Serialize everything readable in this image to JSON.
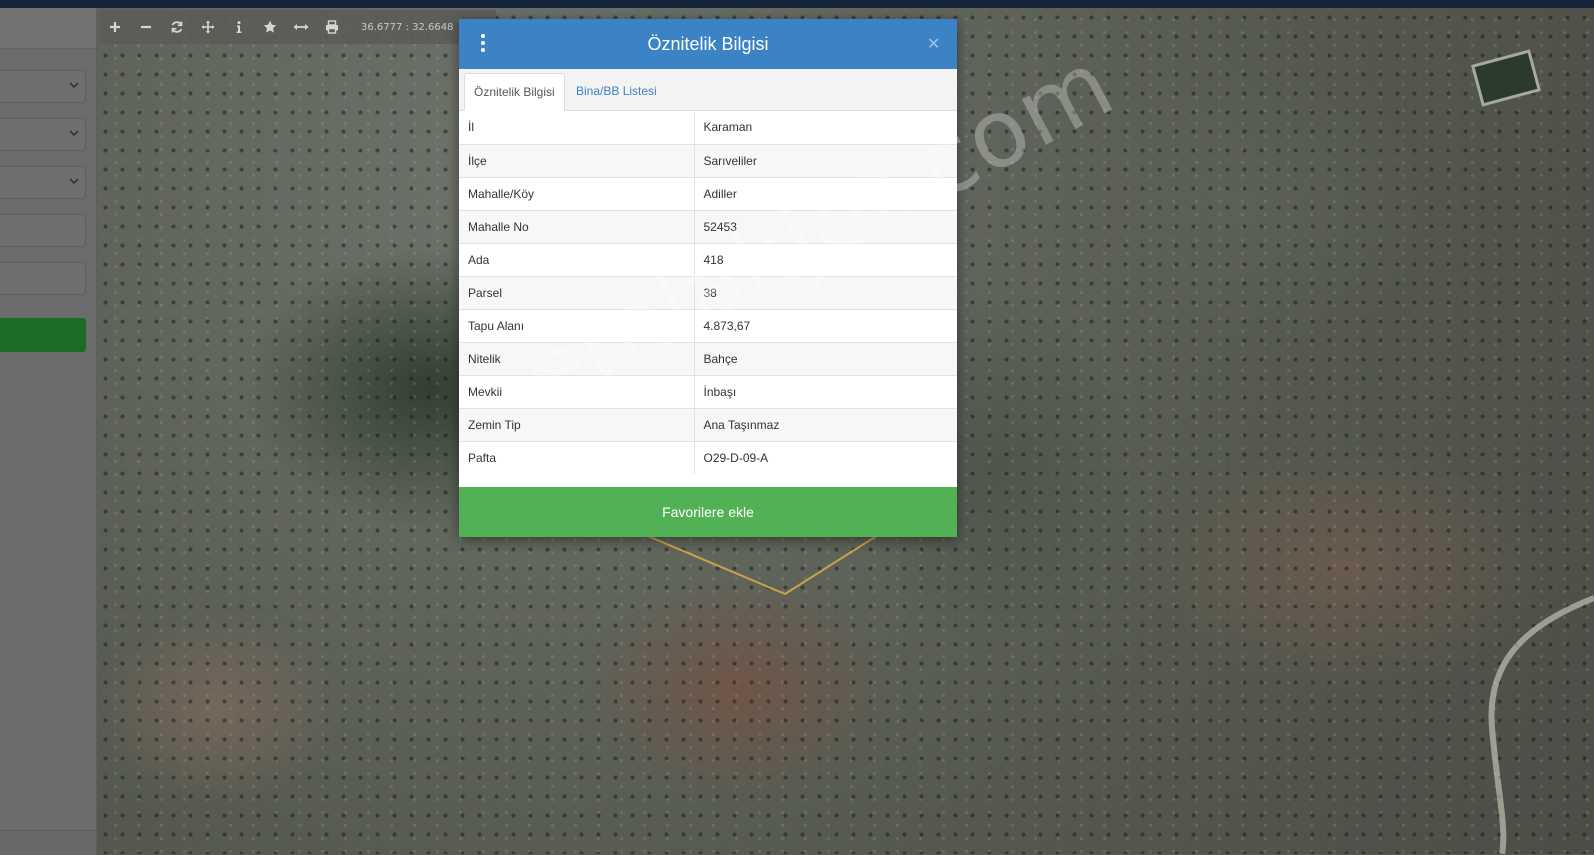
{
  "toolbar": {
    "coords": "36.6777 : 32.6648",
    "buttons": [
      {
        "name": "zoom-in",
        "icon": "plus-icon"
      },
      {
        "name": "zoom-out",
        "icon": "minus-icon"
      },
      {
        "name": "refresh",
        "icon": "refresh-icon"
      },
      {
        "name": "pan",
        "icon": "move-icon"
      },
      {
        "name": "info",
        "icon": "info-icon"
      },
      {
        "name": "favorite",
        "icon": "star-icon"
      },
      {
        "name": "measure",
        "icon": "arrows-horizontal-icon"
      },
      {
        "name": "print",
        "icon": "print-icon"
      }
    ]
  },
  "popup": {
    "title": "Öznitelik Bilgisi",
    "tabs": [
      {
        "label": "Öznitelik Bilgisi",
        "active": true
      },
      {
        "label": "Bina/BB Listesi",
        "active": false
      }
    ],
    "rows": [
      {
        "key": "İl",
        "value": "Karaman"
      },
      {
        "key": "İlçe",
        "value": "Sarıveliler"
      },
      {
        "key": "Mahalle/Köy",
        "value": "Adiller"
      },
      {
        "key": "Mahalle No",
        "value": "52453"
      },
      {
        "key": "Ada",
        "value": "418"
      },
      {
        "key": "Parsel",
        "value": "38"
      },
      {
        "key": "Tapu Alanı",
        "value": "4.873,67"
      },
      {
        "key": "Nitelik",
        "value": "Bahçe"
      },
      {
        "key": "Mevkii",
        "value": "İnbaşı"
      },
      {
        "key": "Zemin Tip",
        "value": "Ana Taşınmaz"
      },
      {
        "key": "Pafta",
        "value": "O29-D-09-A"
      }
    ],
    "favorite_label": "Favorilere ekle"
  },
  "watermark": "emlakjet.com",
  "colors": {
    "header": "#3b83c4",
    "favorite": "#53b155",
    "sidebar_button": "#1d6b25",
    "parcel_outline": "#c9a24a"
  }
}
